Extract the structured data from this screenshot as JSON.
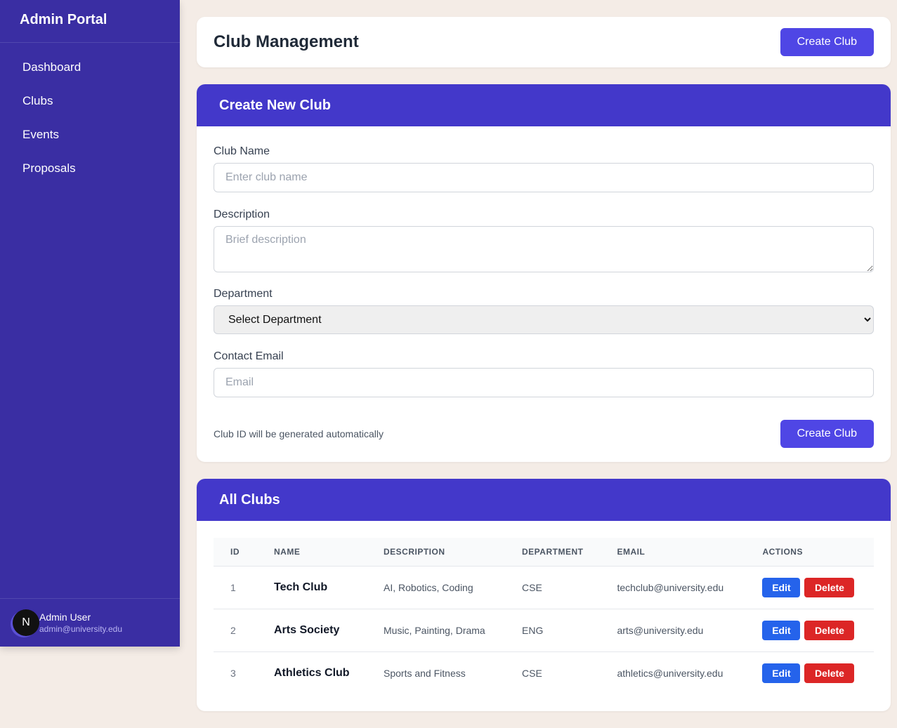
{
  "sidebar": {
    "brand": "Admin Portal",
    "items": [
      {
        "label": "Dashboard"
      },
      {
        "label": "Clubs"
      },
      {
        "label": "Events"
      },
      {
        "label": "Proposals"
      }
    ],
    "user": {
      "avatar_letter": "N",
      "name": "Admin User",
      "email": "admin@university.edu"
    }
  },
  "header": {
    "title": "Club Management",
    "create_button": "Create Club"
  },
  "form": {
    "title": "Create New Club",
    "club_name_label": "Club Name",
    "club_name_placeholder": "Enter club name",
    "description_label": "Description",
    "description_placeholder": "Brief description",
    "department_label": "Department",
    "department_selected": "Select Department",
    "email_label": "Contact Email",
    "email_placeholder": "Email",
    "hint": "Club ID will be generated automatically",
    "submit_label": "Create Club"
  },
  "clubs": {
    "title": "All Clubs",
    "columns": [
      "ID",
      "NAME",
      "DESCRIPTION",
      "DEPARTMENT",
      "EMAIL",
      "ACTIONS"
    ],
    "rows": [
      {
        "id": "1",
        "name": "Tech Club",
        "description": "AI, Robotics, Coding",
        "department": "CSE",
        "email": "techclub@university.edu"
      },
      {
        "id": "2",
        "name": "Arts Society",
        "description": "Music, Painting, Drama",
        "department": "ENG",
        "email": "arts@university.edu"
      },
      {
        "id": "3",
        "name": "Athletics Club",
        "description": "Sports and Fitness",
        "department": "CSE",
        "email": "athletics@university.edu"
      }
    ],
    "edit_label": "Edit",
    "delete_label": "Delete"
  }
}
